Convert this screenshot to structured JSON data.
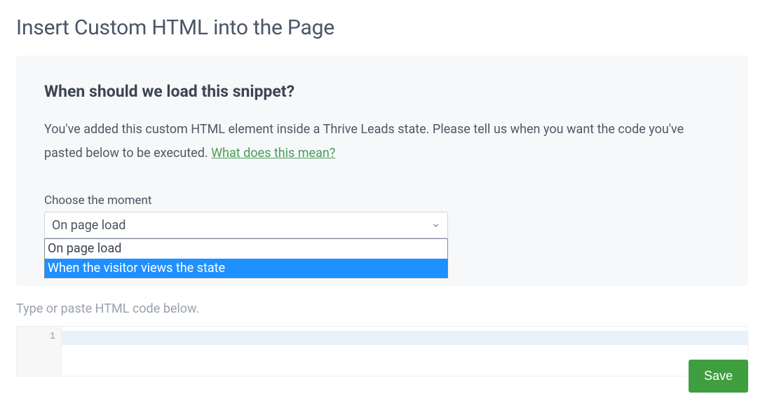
{
  "pageTitle": "Insert Custom HTML into the Page",
  "panel": {
    "heading": "When should we load this snippet?",
    "description": "You've added this custom HTML element inside a Thrive Leads state. Please tell us when you want the code you've pasted below to be executed. ",
    "helpLinkText": "What does this mean?"
  },
  "momentField": {
    "label": "Choose the moment",
    "selected": "On page load",
    "options": [
      "On page load",
      "When the visitor views the state"
    ],
    "highlightedIndex": 1
  },
  "codeArea": {
    "label": "Type or paste HTML code below.",
    "lineNumber": "1"
  },
  "saveButton": "Save"
}
